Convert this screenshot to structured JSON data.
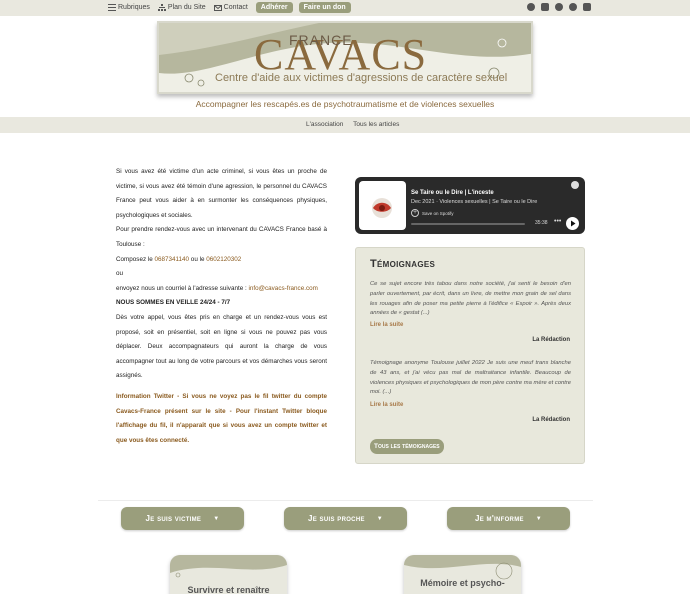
{
  "topbar": {
    "rubriques": "Rubriques",
    "plan": "Plan du Site",
    "contact": "Contact",
    "adherer": "Adhérer",
    "don": "Faire un don",
    "social": [
      "spotify-icon",
      "youtube-icon",
      "twitter-icon",
      "facebook-icon",
      "instagram-icon"
    ]
  },
  "logo": {
    "france": "FRANCE",
    "cavacs": "CAVACS",
    "baseline": "Centre d'aide aux victimes d'agressions de caractère sexuel"
  },
  "tagline": "Accompagner les rescapés.es de psychotraumatisme et de violences sexuelles",
  "subnav": [
    "L'association",
    "Tous les articles"
  ],
  "left": {
    "p1": "Si vous avez été victime d'un acte criminel, si vous êtes un proche de victime, si vous avez été témoin d'une agression, le personnel du CAVACS France peut vous aider à en surmonter les conséquences physiques, psychologiques et sociales.",
    "p2": "Pour prendre rendez-vous avec un intervenant du CAVACS France basé à Toulouse :",
    "p3a": "Composez le ",
    "phone1": "0687341140",
    "p3b": " ou le ",
    "phone2": "0602120302",
    "p4": "ou",
    "p5a": "envoyez nous un courriel à l'adresse suivante : ",
    "email": "info@cavacs-france.com",
    "p6": "NOUS SOMMES EN VEILLE 24/24 - 7/7",
    "p7": "Dès votre appel, vous êtes pris en charge et un rendez-vous vous est proposé, soit en présentiel, soit en ligne si vous ne pouvez pas vous déplacer. Deux accompagnateurs qui auront la charge de vous accompagner tout au long de votre parcours et vos démarches vous seront assignés.",
    "p8": "Information Twitter - Si vous ne voyez pas le fil twitter du compte Cavacs-France présent sur le site - Pour l'instant Twitter bloque l'affichage du fil, il n'apparaît que si vous avez un compte twitter et que vous êtes connecté."
  },
  "spotify": {
    "title": "Se Taire ou le Dire | L'inceste",
    "subtitle": "Dec 2021 · Violences sexuelles | Se Taire ou le Dire",
    "save": "Save on Spotify",
    "time": "35:38",
    "cover_text": "SE TAIRE OU LE DIRE"
  },
  "temoignages": {
    "heading": "Témoignages",
    "items": [
      {
        "quote": "Ce se sujet encore très tabou dans notre société, j'ai senti le besoin d'en parler ouvertement, par écrit, dans un livre, de mettre mon grain de sel dans les rouages afin de poser ma petite pierre à l'édifice « Espoir ». Après deux années de « gestat (...)",
        "more": "Lire la suite",
        "author": "La Rédaction"
      },
      {
        "quote": "Témoignage anonyme Toulouse juillet 2022 Je suis une meuf trans blanche de 43 ans, et j'ai vécu pas mal de maltraitance infantile. Beaucoup de violences physiques et psychologiques de mon père contre ma mère et contre moi. (...)",
        "more": "Lire la suite",
        "author": "La Rédaction"
      }
    ],
    "all_button": "Tous les témoignages"
  },
  "menu_buttons": [
    "Je suis victime",
    "Je suis proche",
    "Je m'informe"
  ],
  "cards": [
    "Survivre et renaître",
    "Mémoire et psycho-"
  ],
  "colors": {
    "olive": "#9a9e7c",
    "brown": "#8a6a3e",
    "link": "#8a5a1e",
    "bar_bg": "#e9e8df"
  }
}
